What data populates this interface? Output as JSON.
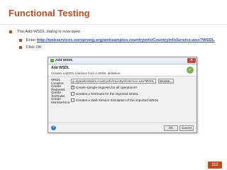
{
  "slide": {
    "title": "Functional Testing",
    "bullets": [
      "The Add WSDL dialog is now open",
      "Enter ",
      "Click OK."
    ],
    "link": "http://webservices.oorsprong.org/websamples.countryinfo/CountryInfoService.wso?WSDL",
    "link_suffix": ".",
    "page_number": "112",
    "colors": {
      "accent": "#c04a1b",
      "link": "#2c4fb0"
    }
  },
  "dialog": {
    "title": "Add WSDL",
    "close_icon": "close-icon",
    "header_title": "Add WSDL",
    "header_subtitle": "Creates a WSDL Interface from a WSDL definition",
    "logo_icon": "soapui-logo-icon",
    "location_label": "WSDL Location:",
    "location_value": "g.org/websamples.countryinfo/CountryInfoService.wso?WSDL",
    "browse_label": "Browse...",
    "options": [
      {
        "label": "Create Requests:",
        "text": "Create sample requests for all operations?",
        "checked": true
      },
      {
        "label": "Create TestSuite:",
        "text": "Creates a TestSuite for the imported WSDL",
        "checked": false
      },
      {
        "label": "Create MockService:",
        "text": "Creates a Web Service Simulation of the imported WSDL",
        "checked": false
      }
    ],
    "help_icon": "help-icon",
    "ok_label": "OK",
    "cancel_label": "Cancel"
  }
}
